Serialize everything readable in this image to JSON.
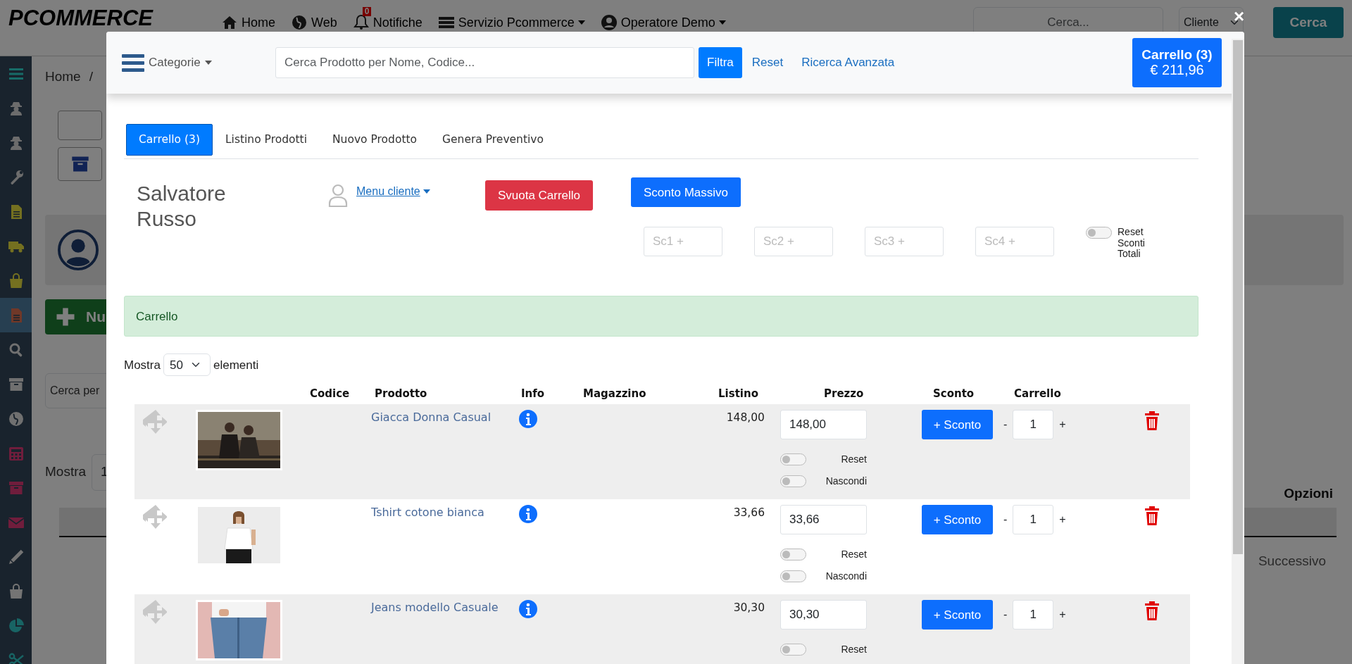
{
  "navbar": {
    "logo": "PCOMMERCE",
    "items": [
      {
        "kind": "home",
        "label": "Home"
      },
      {
        "kind": "web",
        "label": "Web"
      },
      {
        "kind": "bell",
        "label": "Notifiche",
        "badge": "0"
      },
      {
        "kind": "service",
        "label": "Servizio Pcommerce",
        "dropdown": true
      },
      {
        "kind": "user",
        "label": "Operatore Demo",
        "dropdown": true
      }
    ],
    "search": {
      "placeholder": "Cerca..."
    },
    "search_type": "Cliente",
    "search_button": "Cerca"
  },
  "sidebar": {
    "items": [
      {
        "selected": false
      },
      {
        "selected": false
      },
      {
        "selected": false
      },
      {
        "selected": false
      },
      {
        "selected": false
      },
      {
        "selected": false
      },
      {
        "selected": false
      },
      {
        "selected": true
      },
      {
        "selected": false
      },
      {
        "selected": false
      },
      {
        "selected": false
      },
      {
        "selected": false
      },
      {
        "selected": false
      },
      {
        "selected": false
      },
      {
        "selected": false
      },
      {
        "selected": false
      },
      {
        "selected": false
      },
      {
        "selected": false
      }
    ]
  },
  "page": {
    "breadcrumb": [
      "Home",
      "/"
    ],
    "new_button": "Nu",
    "search": {
      "placeholder": "Cerca per"
    },
    "show_label": "Mostra",
    "show_value": "1",
    "options_header": "Opzioni",
    "next_button": "Successivo"
  },
  "modal": {
    "close": "×",
    "categories": "Categorie",
    "search": {
      "placeholder": "Cerca Prodotto per Nome, Codice..."
    },
    "filter_button": "Filtra",
    "reset_link": "Reset",
    "advanced_link": "Ricerca Avanzata",
    "cart_button": {
      "title": "Carrello (3)",
      "total": "€ 211,96"
    },
    "tabs": [
      {
        "label": "Carrello (3)",
        "selected": true
      },
      {
        "label": "Listino Prodotti",
        "selected": false
      },
      {
        "label": "Nuovo Prodotto",
        "selected": false
      },
      {
        "label": "Genera Preventivo",
        "selected": false
      }
    ],
    "customer": {
      "name": "Salvatore Russo",
      "menu": "Menu cliente"
    },
    "empty_cart_button": "Svuota Carrello",
    "bulk_discount_button": "Sconto Massivo",
    "discount_fields": [
      {
        "placeholder": "Sc1 +"
      },
      {
        "placeholder": "Sc2 +"
      },
      {
        "placeholder": "Sc3 +"
      },
      {
        "placeholder": "Sc4 +"
      }
    ],
    "reset_discounts": {
      "label": "Reset Sconti Totali",
      "on": false
    },
    "alert": "Carrello",
    "page_length": {
      "label_before": "Mostra",
      "value": "50",
      "label_after": "elementi"
    },
    "columns": [
      "Codice",
      "Prodotto",
      "Info",
      "Magazzino",
      "Listino",
      "Prezzo",
      "Sconto",
      "Carrello"
    ],
    "rows": [
      {
        "product": "Giacca Donna Casual",
        "list_price": "148,00",
        "price": "148,00",
        "discount_button": "+ Sconto",
        "minus": "-",
        "quantity": "1",
        "plus": "+",
        "reset": {
          "label": "Reset",
          "on": false
        },
        "hide": {
          "label": "Nascondi",
          "on": false
        }
      },
      {
        "product": "Tshirt cotone bianca",
        "list_price": "33,66",
        "price": "33,66",
        "discount_button": "+ Sconto",
        "minus": "-",
        "quantity": "1",
        "plus": "+",
        "reset": {
          "label": "Reset",
          "on": false
        },
        "hide": {
          "label": "Nascondi",
          "on": false
        }
      },
      {
        "product": "Jeans modello Casuale",
        "list_price": "30,30",
        "price": "30,30",
        "discount_button": "+ Sconto",
        "minus": "-",
        "quantity": "1",
        "plus": "+",
        "reset": {
          "label": "Reset",
          "on": false
        }
      }
    ]
  }
}
